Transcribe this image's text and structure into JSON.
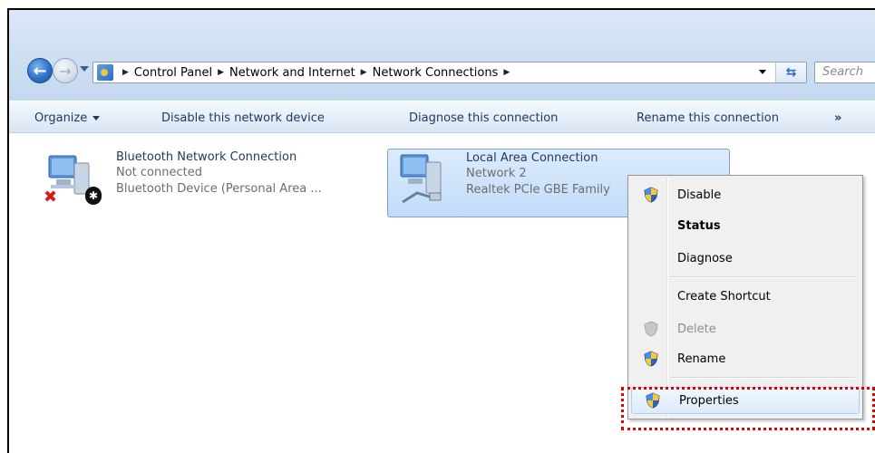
{
  "address_bar": {
    "crumbs": [
      "Control Panel",
      "Network and Internet",
      "Network Connections"
    ],
    "search_placeholder": "Search"
  },
  "command_bar": {
    "organize": "Organize",
    "disable_device": "Disable this network device",
    "diagnose": "Diagnose this connection",
    "rename": "Rename this connection",
    "more": "»"
  },
  "connections": [
    {
      "name": "Bluetooth Network Connection",
      "status": "Not connected",
      "device": "Bluetooth Device (Personal Area ..."
    },
    {
      "name": "Local Area Connection",
      "status": "Network  2",
      "device": "Realtek PCIe GBE Family"
    }
  ],
  "context_menu": {
    "items": [
      "Disable",
      "Status",
      "Diagnose",
      "Create Shortcut",
      "Delete",
      "Rename",
      "Properties"
    ]
  },
  "colors": {
    "selection": "#c1dcfa",
    "highlight_border": "#e00000",
    "error_x": "#d8171b"
  }
}
